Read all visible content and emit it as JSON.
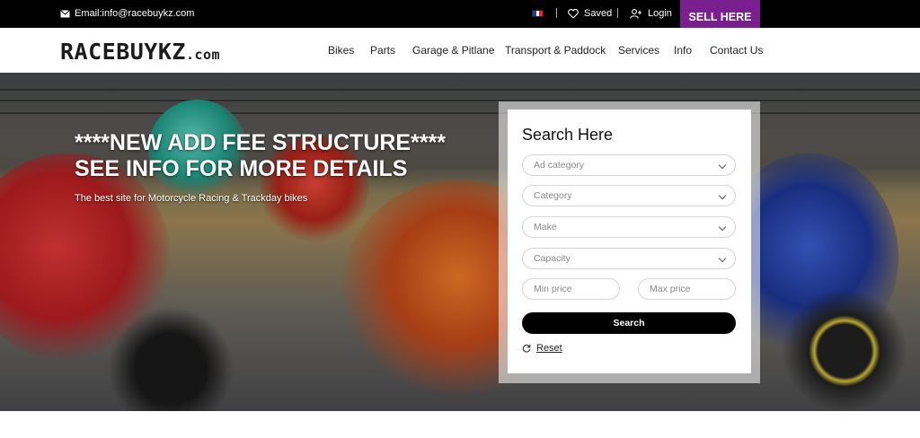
{
  "topbar": {
    "email": "Email:info@racebuykz.com",
    "saved": "Saved",
    "login": "Login",
    "sell": "SELL HERE",
    "flag_colors": [
      "#1f3f99",
      "#ffffff",
      "#e3252e"
    ]
  },
  "header": {
    "logo_main": "RACEBUYKZ",
    "logo_suffix": ".com",
    "nav": [
      "Bikes",
      "Parts",
      "Garage & Pitlane",
      "Transport & Paddock",
      "Services",
      "Info",
      "Contact Us"
    ]
  },
  "hero": {
    "headline_1": "****NEW ADD FEE STRUCTURE****",
    "headline_2": "SEE INFO FOR MORE DETAILS",
    "tagline": "The best site for Motorcycle Racing & Trackday bikes"
  },
  "search": {
    "title": "Search Here",
    "ad_category": "Ad category",
    "category": "Category",
    "make": "Make",
    "capacity": "Capacity",
    "min_price": "Min price",
    "max_price": "Max price",
    "button": "Search",
    "reset": "Reset"
  },
  "colors": {
    "accent": "#7a1f90",
    "topbar": "#000000"
  }
}
